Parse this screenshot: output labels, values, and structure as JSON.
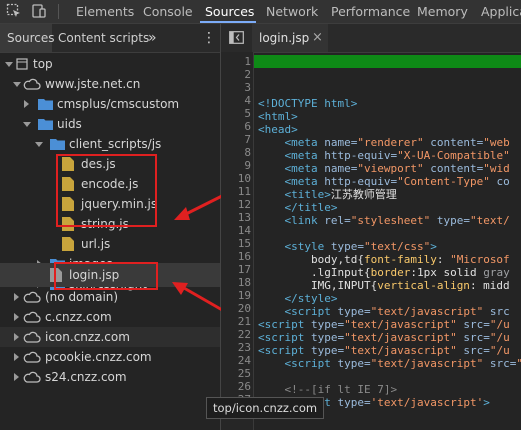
{
  "toolbar": {
    "tabs": [
      "Elements",
      "Console",
      "Sources",
      "Network",
      "Performance",
      "Memory",
      "Applica"
    ],
    "active_tab": "Sources",
    "icons": [
      "inspect-element-icon",
      "device-toggle-icon"
    ]
  },
  "navigator": {
    "tabs": [
      "Sources",
      "Content scripts"
    ],
    "more": "»",
    "menu": "⋮"
  },
  "tree": [
    {
      "label": "top",
      "kind": "frame"
    },
    {
      "label": "www.jste.net.cn",
      "kind": "cloud"
    },
    {
      "label": "cmsplus/cmscustom",
      "kind": "folder"
    },
    {
      "label": "uids",
      "kind": "folder"
    },
    {
      "label": "client_scripts/js",
      "kind": "folder"
    },
    {
      "label": "des.js",
      "kind": "file"
    },
    {
      "label": "encode.js",
      "kind": "file"
    },
    {
      "label": "jquery.min.js",
      "kind": "file"
    },
    {
      "label": "string.js",
      "kind": "file"
    },
    {
      "label": "url.js",
      "kind": "file"
    },
    {
      "label": "images",
      "kind": "folder"
    },
    {
      "label": "skin/css/light",
      "kind": "folder"
    },
    {
      "label": "login.jsp",
      "kind": "page"
    },
    {
      "label": "(no domain)",
      "kind": "cloud"
    },
    {
      "label": "c.cnzz.com",
      "kind": "cloud"
    },
    {
      "label": "icon.cnzz.com",
      "kind": "cloud"
    },
    {
      "label": "pcookie.cnzz.com",
      "kind": "cloud"
    },
    {
      "label": "s24.cnzz.com",
      "kind": "cloud"
    }
  ],
  "editor": {
    "file_tab": "login.jsp",
    "close": "×",
    "line_numbers": [
      "1",
      "2",
      "3",
      "4",
      "5",
      "6",
      "7",
      "8",
      "9",
      "10",
      "11",
      "12",
      "13",
      "14",
      "15",
      "16",
      "17",
      "18",
      "19",
      "20",
      "21",
      "22",
      "23",
      "24",
      "25",
      "26",
      "27"
    ],
    "title_text": "江苏教师管理"
  },
  "tooltip": "top/icon.cnzz.com",
  "colors": {
    "annotation": "#e02020",
    "highlight_line": "#0e8a16",
    "accent": "#7cacf8"
  }
}
